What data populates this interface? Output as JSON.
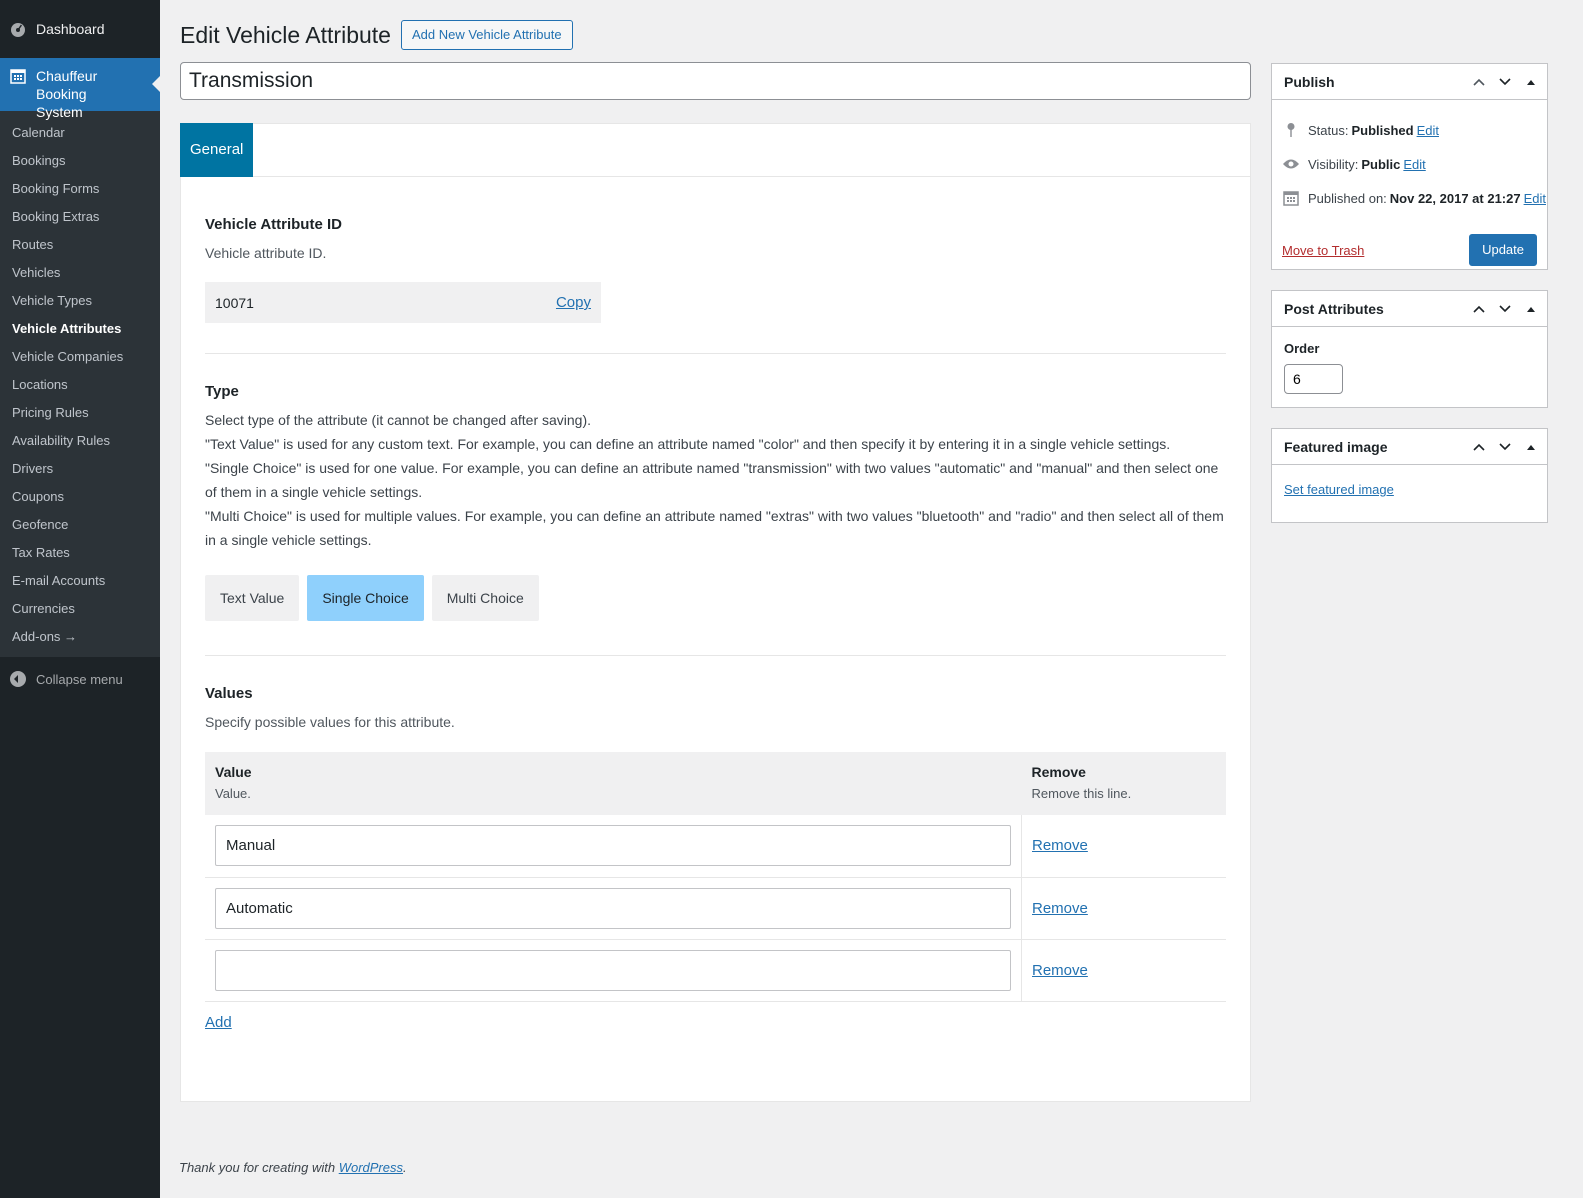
{
  "sidebar": {
    "dashboard": "Dashboard",
    "plugin": "Chauffeur Booking System",
    "items": [
      {
        "label": "Calendar"
      },
      {
        "label": "Bookings"
      },
      {
        "label": "Booking Forms"
      },
      {
        "label": "Booking Extras"
      },
      {
        "label": "Routes"
      },
      {
        "label": "Vehicles"
      },
      {
        "label": "Vehicle Types"
      },
      {
        "label": "Vehicle Attributes",
        "current": true
      },
      {
        "label": "Vehicle Companies"
      },
      {
        "label": "Locations"
      },
      {
        "label": "Pricing Rules"
      },
      {
        "label": "Availability Rules"
      },
      {
        "label": "Drivers"
      },
      {
        "label": "Coupons"
      },
      {
        "label": "Geofence"
      },
      {
        "label": "Tax Rates"
      },
      {
        "label": "E-mail Accounts"
      },
      {
        "label": "Currencies"
      },
      {
        "label": "Add-ons →"
      }
    ],
    "collapse": "Collapse menu"
  },
  "header": {
    "title": "Edit Vehicle Attribute",
    "add_new": "Add New Vehicle Attribute"
  },
  "post_title": "Transmission",
  "tabs": [
    {
      "label": "General"
    }
  ],
  "attr_id": {
    "title": "Vehicle Attribute ID",
    "desc": "Vehicle attribute ID.",
    "value": "10071",
    "copy": "Copy"
  },
  "type": {
    "title": "Type",
    "desc_lines": [
      "Select type of the attribute (it cannot be changed after saving).",
      "\"Text Value\" is used for any custom text. For example, you can define an attribute named \"color\" and then specify it by entering it in a single vehicle settings.",
      "\"Single Choice\" is used for one value. For example, you can define an attribute named \"transmission\" with two values \"automatic\" and \"manual\" and then select one of them in a single vehicle settings.",
      "\"Multi Choice\" is used for multiple values. For example, you can define an attribute named \"extras\" with two values \"bluetooth\" and \"radio\" and then select all of them in a single vehicle settings."
    ],
    "options": [
      "Text Value",
      "Single Choice",
      "Multi Choice"
    ],
    "selected": "Single Choice"
  },
  "values": {
    "title": "Values",
    "desc": "Specify possible values for this attribute.",
    "col_value": "Value",
    "col_value_desc": "Value.",
    "col_remove": "Remove",
    "col_remove_desc": "Remove this line.",
    "rows": [
      {
        "value": "Manual",
        "remove": "Remove"
      },
      {
        "value": "Automatic",
        "remove": "Remove"
      },
      {
        "value": "",
        "remove": "Remove"
      }
    ],
    "add": "Add"
  },
  "publish": {
    "title": "Publish",
    "status_label": "Status:",
    "status_value": "Published",
    "visibility_label": "Visibility:",
    "visibility_value": "Public",
    "published_label": "Published on:",
    "published_value": "Nov 22, 2017 at 21:27",
    "edit": "Edit",
    "trash": "Move to Trash",
    "update": "Update"
  },
  "post_attributes": {
    "title": "Post Attributes",
    "order_label": "Order",
    "order_value": "6"
  },
  "featured": {
    "title": "Featured image",
    "set": "Set featured image"
  },
  "footer": {
    "text": "Thank you for creating with ",
    "link": "WordPress",
    "suffix": "."
  },
  "colors": {
    "accent": "#2271b1",
    "tab": "#0074a2",
    "selected_choice": "#8fd0fc",
    "sidebar": "#1d2327",
    "trash": "#b32d2e"
  }
}
